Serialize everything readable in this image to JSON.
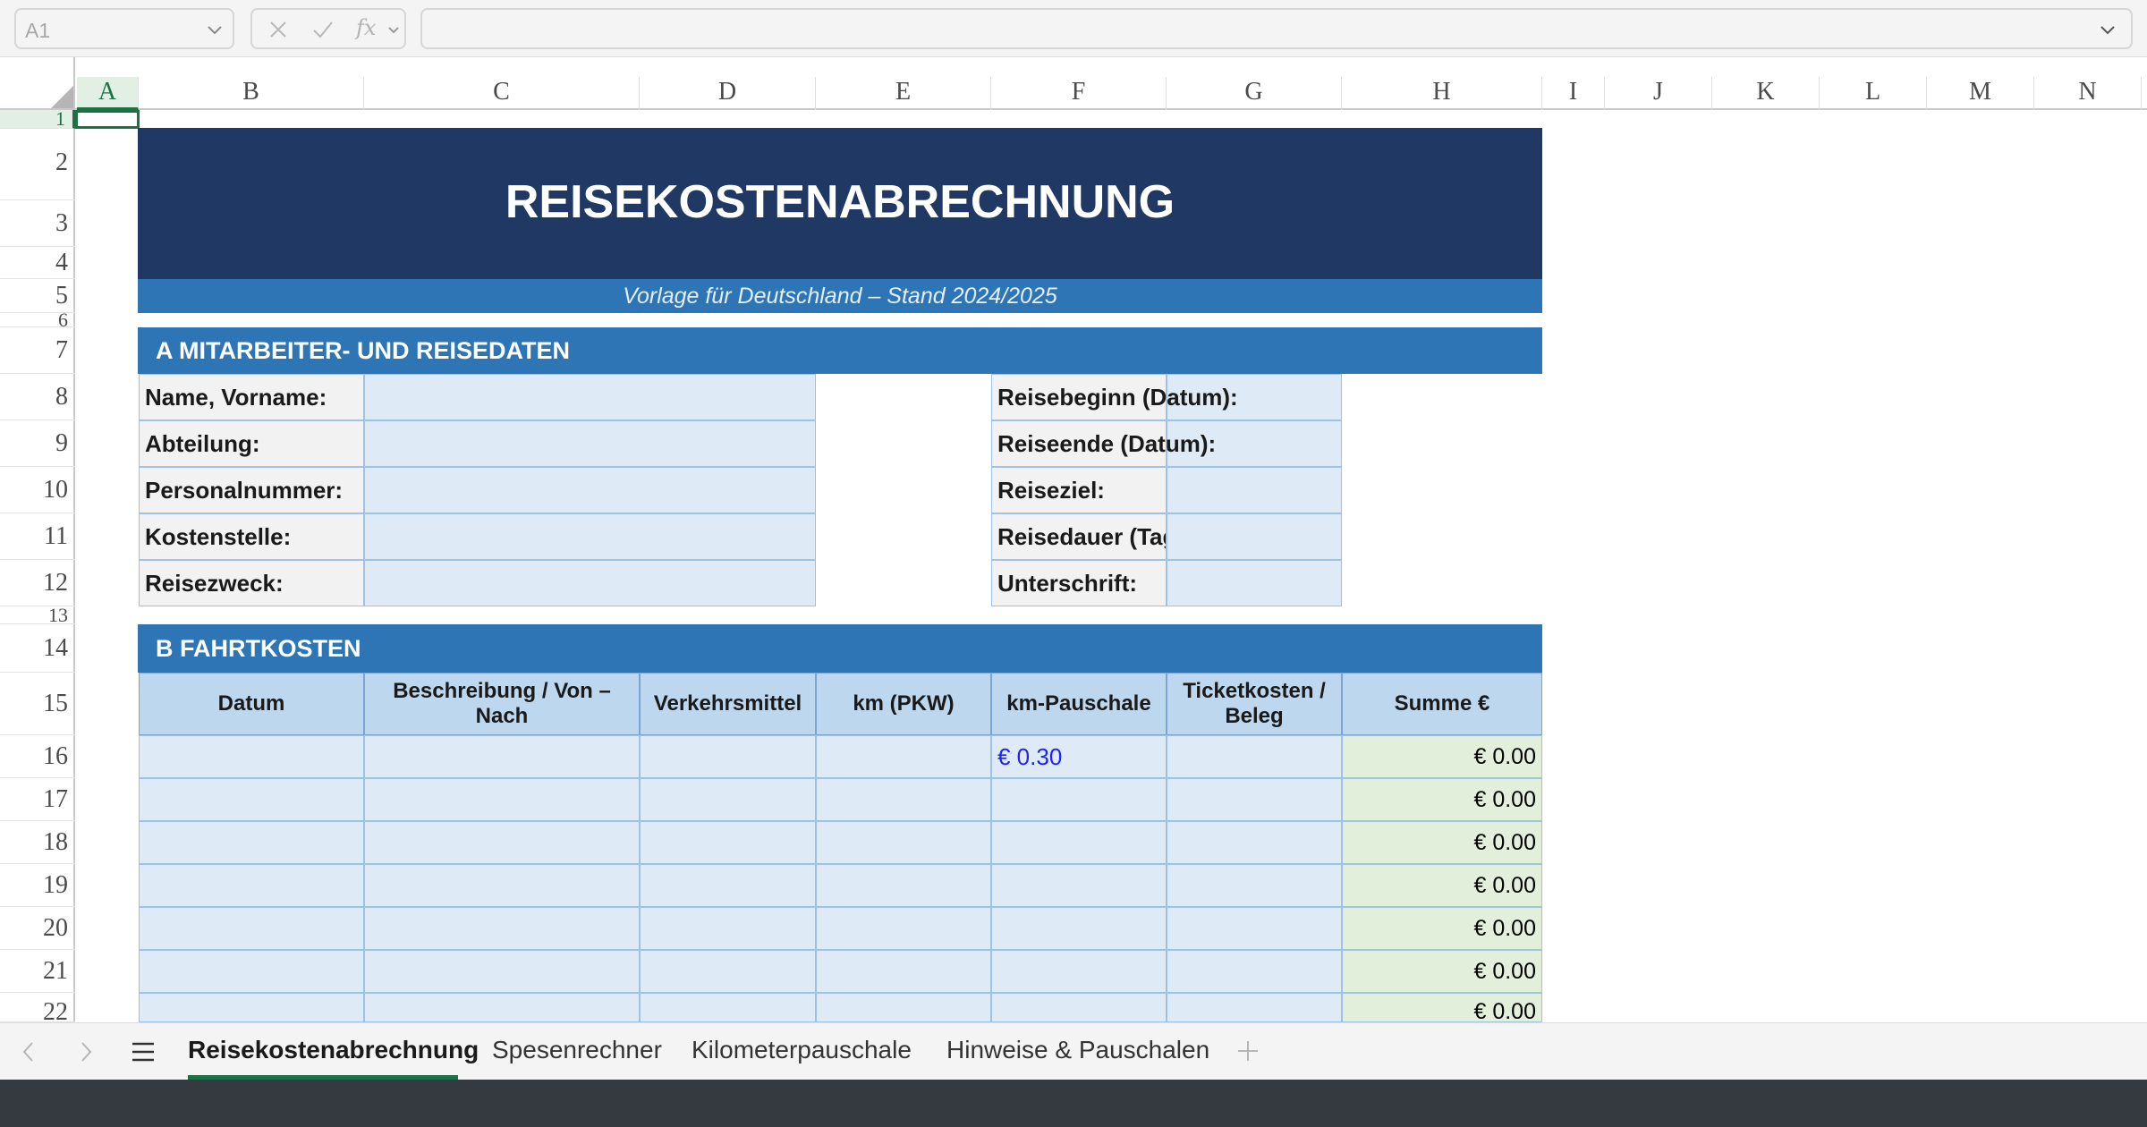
{
  "formula_bar": {
    "name_box": "A1",
    "fx_label": "fx",
    "formula_value": ""
  },
  "columns": [
    "A",
    "B",
    "C",
    "D",
    "E",
    "F",
    "G",
    "H",
    "I",
    "J",
    "K",
    "L",
    "M",
    "N"
  ],
  "rows": [
    "1",
    "2",
    "3",
    "4",
    "5",
    "6",
    "7",
    "8",
    "9",
    "10",
    "11",
    "12",
    "13",
    "14",
    "15",
    "16",
    "17",
    "18",
    "19",
    "20",
    "21",
    "22"
  ],
  "sheet": {
    "title": "REISEKOSTENABRECHNUNG",
    "subtitle": "Vorlage für Deutschland – Stand 2024/2025",
    "section_a": {
      "label": "A  MITARBEITER- UND REISEDATEN",
      "left_fields": [
        "Name, Vorname:",
        "Abteilung:",
        "Personalnummer:",
        "Kostenstelle:",
        "Reisezweck:"
      ],
      "right_fields": [
        "Reisebeginn (Datum):",
        "Reiseende (Datum):",
        "Reiseziel:",
        "Reisedauer (Tage):",
        "Unterschrift:"
      ]
    },
    "section_b": {
      "label": "B  FAHRTKOSTEN",
      "headers": [
        "Datum",
        "Beschreibung / Von – Nach",
        "Verkehrsmittel",
        "km (PKW)",
        "km-Pauschale",
        "Ticketkosten / Beleg",
        "Summe €"
      ],
      "km_rate": "€ 0.30",
      "sums": [
        "€ 0.00",
        "€ 0.00",
        "€ 0.00",
        "€ 0.00",
        "€ 0.00",
        "€ 0.00",
        "€ 0.00"
      ]
    }
  },
  "tabs": [
    "Reisekostenabrechnung",
    "Spesenrechner",
    "Kilometerpauschale",
    "Hinweise & Pauschalen"
  ],
  "colors": {
    "title_band": "#1f3864",
    "section_band": "#2e75b6",
    "input_cell": "#deeaf6",
    "header_cell": "#bdd7ee",
    "sum_cell": "#e2efda",
    "accent": "#1e7145"
  }
}
